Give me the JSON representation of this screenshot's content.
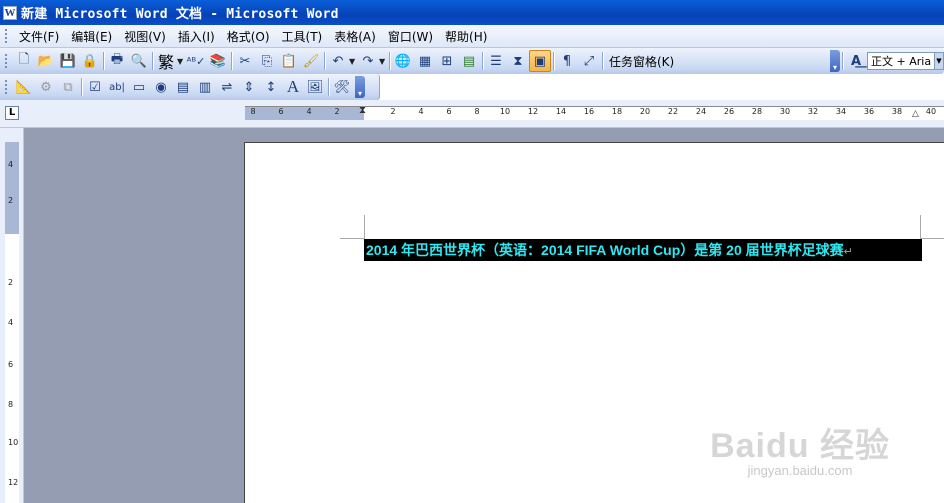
{
  "window": {
    "title": "新建 Microsoft Word 文档 - Microsoft Word",
    "app_icon": "W"
  },
  "menu": [
    "文件(F)",
    "编辑(E)",
    "视图(V)",
    "插入(I)",
    "格式(O)",
    "工具(T)",
    "表格(A)",
    "窗口(W)",
    "帮助(H)"
  ],
  "toolbar": {
    "traditional_chinese": "繁",
    "task_pane": "任务窗格(K)",
    "style_value": "正文 + Aria"
  },
  "ruler": {
    "top_numbers": [
      "8",
      "6",
      "4",
      "2",
      "2",
      "4",
      "6",
      "8",
      "10",
      "12",
      "14",
      "16",
      "18",
      "20",
      "22",
      "24",
      "26",
      "28",
      "30",
      "32",
      "34",
      "36",
      "38",
      "40"
    ],
    "left_numbers": [
      "4",
      "2",
      "2",
      "4",
      "6",
      "8",
      "10",
      "12"
    ]
  },
  "document": {
    "line1": "2014 年巴西世界杯（英语：2014 FIFA World Cup）是第 20 届世界杯足球赛",
    "pilcrow": "↵"
  },
  "watermark": {
    "brand": "Baidu 经验",
    "url": "jingyan.baidu.com"
  },
  "colors": {
    "titlebar": "#0a5fd8",
    "selection_text": "#2ee8f2",
    "workspace": "#959db3"
  }
}
